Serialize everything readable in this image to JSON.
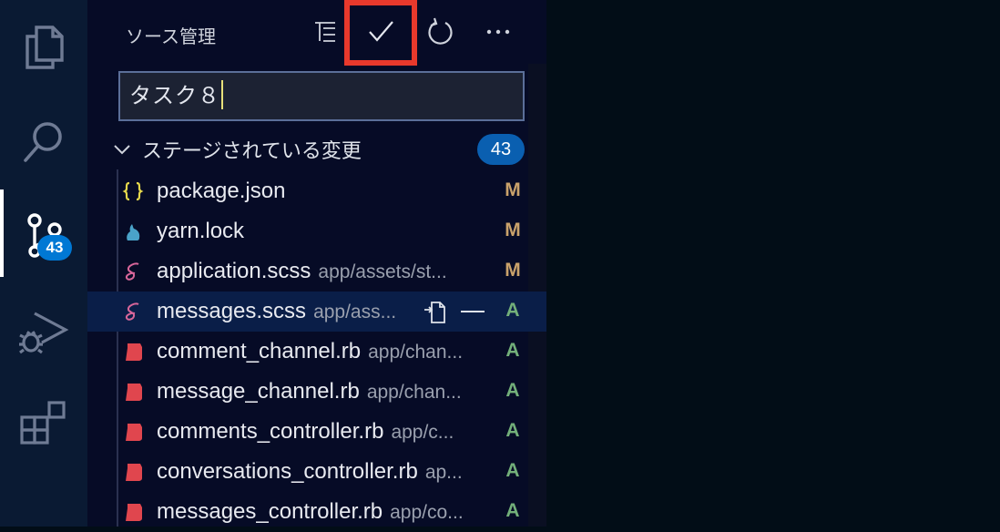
{
  "colors": {
    "highlight_box": "#e8392c",
    "badge": "#0078d4",
    "modified": "#c9a26b",
    "added": "#73b07a",
    "json_icon": "#e5d84c",
    "yarn_icon": "#4aa3c9",
    "scss_icon": "#d8669a",
    "ruby_icon": "#e0464e"
  },
  "activity_bar": {
    "items": [
      {
        "name": "explorer",
        "icon": "files-icon"
      },
      {
        "name": "search",
        "icon": "search-icon"
      },
      {
        "name": "source-control",
        "icon": "source-control-icon",
        "active": true,
        "badge": "43"
      },
      {
        "name": "run-debug",
        "icon": "run-debug-icon"
      },
      {
        "name": "extensions",
        "icon": "extensions-icon"
      }
    ],
    "scm_badge": "43"
  },
  "sidebar": {
    "title": "ソース管理",
    "toolbar": [
      {
        "name": "view-as-tree",
        "icon": "list-tree-icon"
      },
      {
        "name": "commit",
        "icon": "check-icon",
        "highlighted": true
      },
      {
        "name": "refresh",
        "icon": "refresh-icon"
      },
      {
        "name": "more-actions",
        "icon": "ellipsis-icon"
      }
    ],
    "commit_message": "タスク８",
    "section": {
      "label": "ステージされている変更",
      "count": "43"
    },
    "files": [
      {
        "name": "package.json",
        "path": "",
        "status": "M",
        "icon": "json-icon"
      },
      {
        "name": "yarn.lock",
        "path": "",
        "status": "M",
        "icon": "yarn-icon"
      },
      {
        "name": "application.scss",
        "path": "app/assets/st...",
        "status": "M",
        "icon": "scss-icon"
      },
      {
        "name": "messages.scss",
        "path": "app/ass...",
        "status": "A",
        "icon": "scss-icon",
        "selected": true
      },
      {
        "name": "comment_channel.rb",
        "path": "app/chan...",
        "status": "A",
        "icon": "ruby-icon"
      },
      {
        "name": "message_channel.rb",
        "path": "app/chan...",
        "status": "A",
        "icon": "ruby-icon"
      },
      {
        "name": "comments_controller.rb",
        "path": "app/c...",
        "status": "A",
        "icon": "ruby-icon"
      },
      {
        "name": "conversations_controller.rb",
        "path": "ap...",
        "status": "A",
        "icon": "ruby-icon"
      },
      {
        "name": "messages_controller.rb",
        "path": "app/co...",
        "status": "A",
        "icon": "ruby-icon"
      }
    ]
  }
}
